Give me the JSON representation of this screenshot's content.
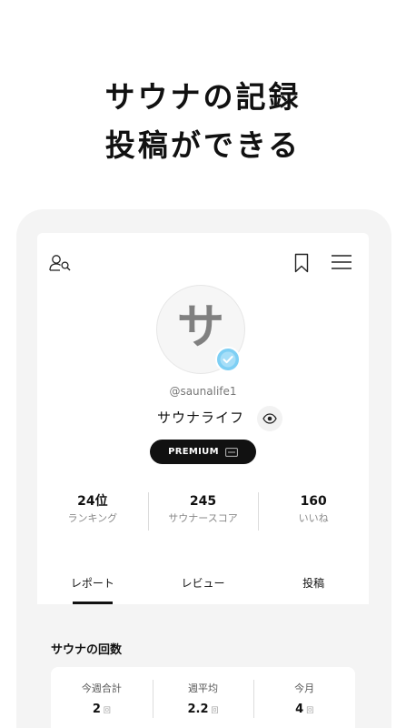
{
  "headline": {
    "line1": "サウナの記録",
    "line2": "投稿ができる"
  },
  "header": {
    "icons": [
      "user-search-icon",
      "bookmark-icon",
      "hamburger-menu-icon"
    ]
  },
  "profile": {
    "avatar_letter": "サ",
    "verified_icon": "check-badge-icon",
    "verified_color": "#7ecff4",
    "handle": "@saunalife1",
    "name": "サウナライフ",
    "visibility_icon": "eye-icon",
    "premium_label": "PREMIUM",
    "premium_icon": "card-icon"
  },
  "stats": [
    {
      "value": "24位",
      "label": "ランキング"
    },
    {
      "value": "245",
      "label": "サウナースコア"
    },
    {
      "value": "160",
      "label": "いいね"
    }
  ],
  "tabs": [
    {
      "label": "レポート",
      "active": true
    },
    {
      "label": "レビュー",
      "active": false
    },
    {
      "label": "投稿",
      "active": false
    }
  ],
  "sauna_count": {
    "title": "サウナの回数",
    "items": [
      {
        "label": "今週合計",
        "value": "2",
        "unit": "回"
      },
      {
        "label": "週平均",
        "value": "2.2",
        "unit": "回"
      },
      {
        "label": "今月",
        "value": "4",
        "unit": "回"
      }
    ]
  }
}
